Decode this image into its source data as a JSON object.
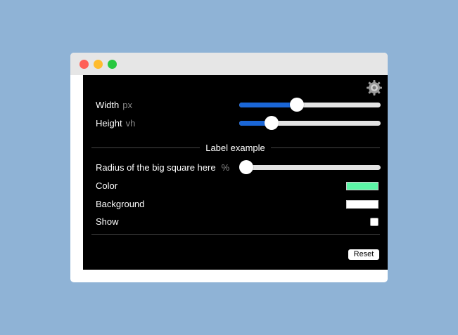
{
  "window": {
    "buttons": [
      "close",
      "minimize",
      "maximize"
    ]
  },
  "settings_icon": "gear-icon",
  "controls": {
    "width": {
      "label": "Width",
      "unit": "px",
      "value_fraction": 0.41
    },
    "height": {
      "label": "Height",
      "unit": "vh",
      "value_fraction": 0.23
    },
    "section_label": "Label example",
    "radius": {
      "label": "Radius of the big square here",
      "unit": "%",
      "value_fraction": 0.0
    },
    "color": {
      "label": "Color",
      "value": "#5cf5a6"
    },
    "background": {
      "label": "Background",
      "value": "#ffffff"
    },
    "show": {
      "label": "Show",
      "checked": false
    },
    "reset_label": "Reset"
  },
  "colors": {
    "page_background": "#8fb3d6",
    "panel_background": "#000000",
    "slider_fill": "#1a66d6"
  }
}
